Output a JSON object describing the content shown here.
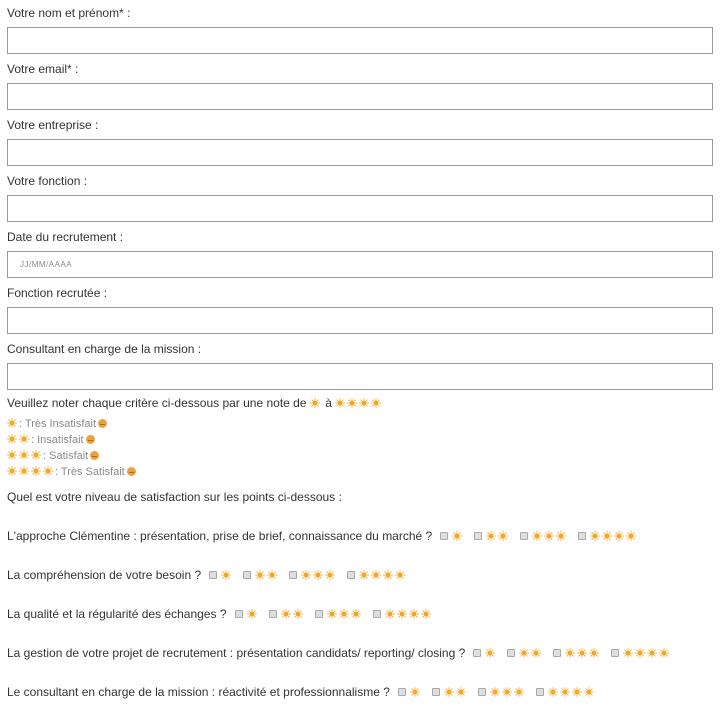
{
  "colors": {
    "accent_sun": "#f5a623",
    "input_border": "#9a9a9a",
    "text": "#333333",
    "legend_text": "#8a8a8a"
  },
  "form": {
    "fields": [
      {
        "label": "Votre nom et prénom* :",
        "value": "",
        "placeholder": ""
      },
      {
        "label": "Votre email* :",
        "value": "",
        "placeholder": ""
      },
      {
        "label": "Votre entreprise :",
        "value": "",
        "placeholder": ""
      },
      {
        "label": "Votre fonction :",
        "value": "",
        "placeholder": ""
      },
      {
        "label": "Date du recrutement :",
        "value": "",
        "placeholder": "JJ/MM/AAAA"
      },
      {
        "label": "Fonction recrutée :",
        "value": "",
        "placeholder": ""
      },
      {
        "label": "Consultant en charge de la mission :",
        "value": "",
        "placeholder": ""
      }
    ]
  },
  "rating": {
    "intro_prefix": "Veuillez noter chaque critère ci-dessous par une note de",
    "intro_min_suns": 1,
    "intro_joiner": "à",
    "intro_max_suns": 4,
    "icon": "sun-icon",
    "legend": [
      {
        "suns": 1,
        "text": ": Très Insatisfait",
        "emoji": "very-unhappy-face-icon"
      },
      {
        "suns": 2,
        "text": ": Insatisfait",
        "emoji": "unhappy-face-icon"
      },
      {
        "suns": 3,
        "text": ": Satisfait",
        "emoji": "smiling-face-icon"
      },
      {
        "suns": 4,
        "text": ": Très Satisfait",
        "emoji": "very-happy-face-icon"
      }
    ]
  },
  "questions": {
    "intro": "Quel est votre niveau de satisfaction sur les points ci-dessous :",
    "options": [
      1,
      2,
      3,
      4
    ],
    "items": [
      {
        "text": "L'approche Clémentine : présentation, prise de brief, connaissance du marché ?",
        "selected": null
      },
      {
        "text": "La compréhension de votre besoin ?",
        "selected": null
      },
      {
        "text": "La qualité et la régularité des échanges ?",
        "selected": null
      },
      {
        "text": "La gestion de votre projet de recrutement : présentation candidats/ reporting/ closing ?",
        "selected": null
      },
      {
        "text": "Le consultant en charge de la mission : réactivité et professionnalisme ?",
        "selected": null
      }
    ]
  }
}
